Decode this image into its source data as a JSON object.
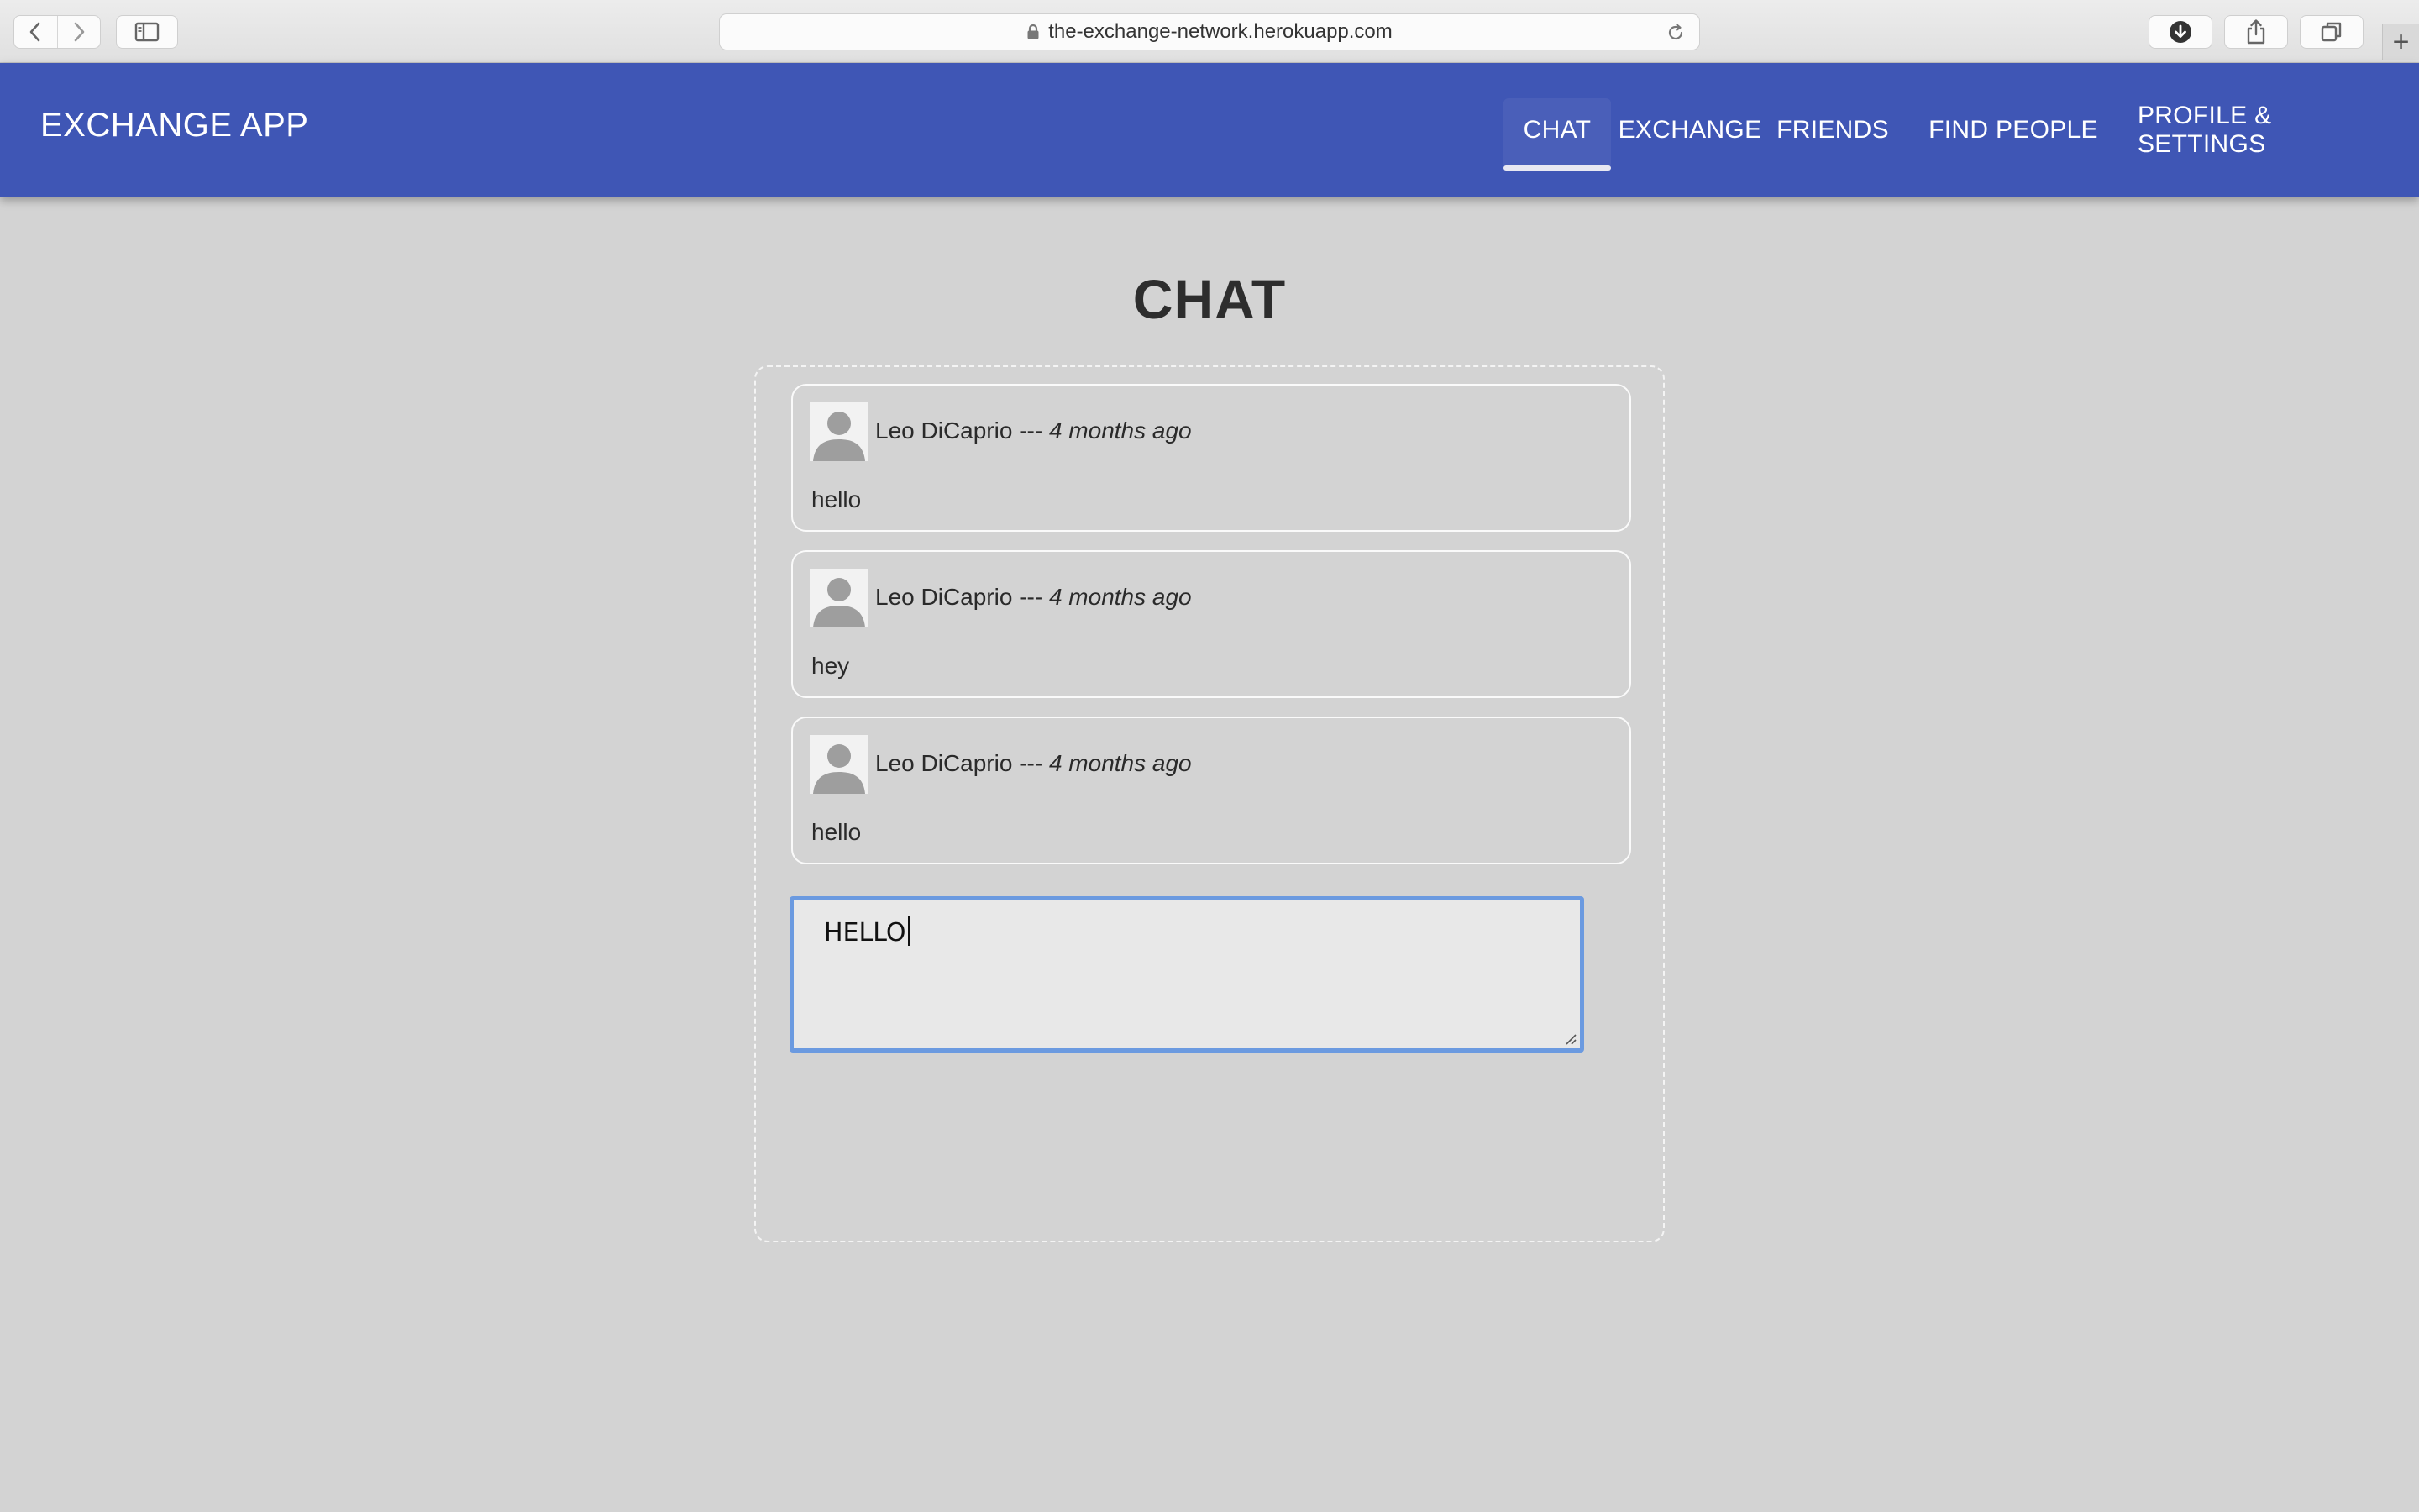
{
  "browser": {
    "url": "the-exchange-network.herokuapp.com",
    "new_tab_label": "+"
  },
  "app": {
    "brand": "EXCHANGE APP",
    "nav": [
      {
        "label": "CHAT",
        "active": true
      },
      {
        "label": "EXCHANGE",
        "active": false
      },
      {
        "label": "FRIENDS",
        "active": false
      },
      {
        "label": "FIND PEOPLE",
        "active": false
      },
      {
        "label": "PROFILE & SETTINGS",
        "active": false
      }
    ],
    "accent_color": "#3f56b5"
  },
  "chat": {
    "title": "CHAT",
    "messages": [
      {
        "author": "Leo DiCaprio",
        "separator": " --- ",
        "time": "4 months ago",
        "text": "hello"
      },
      {
        "author": "Leo DiCaprio",
        "separator": " --- ",
        "time": "4 months ago",
        "text": "hey"
      },
      {
        "author": "Leo DiCaprio",
        "separator": " --- ",
        "time": "4 months ago",
        "text": "hello"
      }
    ],
    "composer_value": "HELLO"
  }
}
